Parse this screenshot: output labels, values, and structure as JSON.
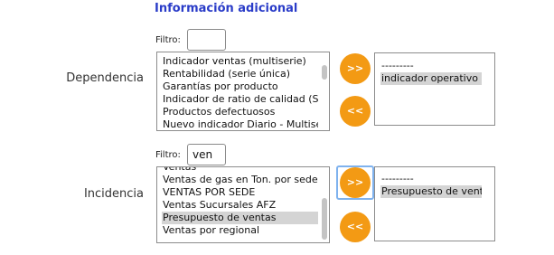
{
  "section_title": "Información adicional",
  "colors": {
    "accent": "#f39a14",
    "title": "#2a3cc8",
    "selected": "#d4d4d4"
  },
  "dependencia": {
    "label": "Dependencia",
    "filter_label": "Filtro:",
    "filter_value": "",
    "available": [
      "Indicador ventas (multiserie)",
      "Rentabilidad (serie única)",
      "Garantías por producto",
      "Indicador de ratio de calidad (Se",
      "Productos defectuosos",
      "Nuevo indicador Diario - Multiser"
    ],
    "add_button": ">>",
    "remove_button": "<<",
    "selected_items": [
      "---------",
      "indicador operativo"
    ]
  },
  "incidencia": {
    "label": "Incidencia",
    "filter_label": "Filtro:",
    "filter_value": "ven",
    "available": [
      "Ventas",
      "Ventas de gas en Ton. por sede",
      "VENTAS POR SEDE",
      "Ventas Sucursales AFZ",
      "Presupuesto de ventas",
      "Ventas por regional"
    ],
    "add_button": ">>",
    "remove_button": "<<",
    "selected_items": [
      "---------",
      "Presupuesto de ventas"
    ]
  }
}
